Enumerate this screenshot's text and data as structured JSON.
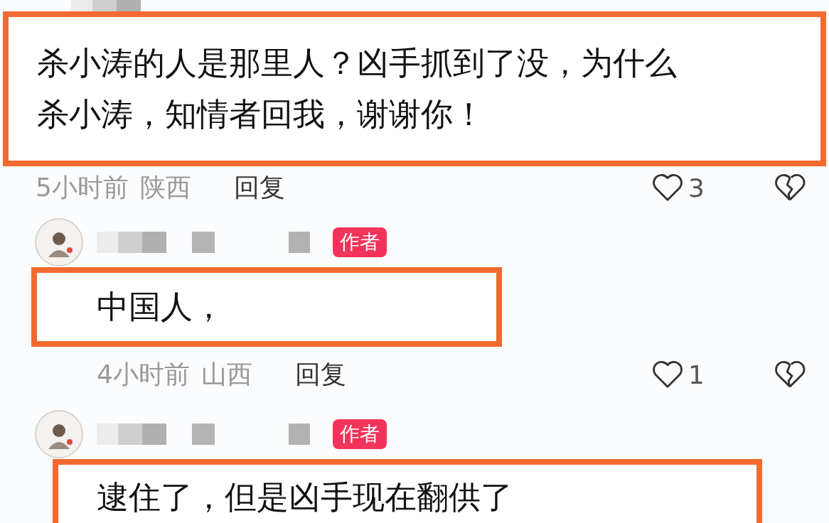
{
  "comments": [
    {
      "highlighted": true,
      "text": [
        "杀小涛的人是那里人？凶手抓到了没，为什么",
        "杀小涛，知情者回我，谢谢你！"
      ],
      "time": "5小时前",
      "region": "陕西",
      "reply": "回复",
      "likes": "3"
    },
    {
      "author_badge": "作者",
      "highlighted": true,
      "text": [
        "中国人，"
      ],
      "time": "4小时前",
      "region": "山西",
      "reply": "回复",
      "likes": "1"
    },
    {
      "author_badge": "作者",
      "highlighted": true,
      "text": [
        "逮住了，但是凶手现在翻供了"
      ]
    }
  ]
}
